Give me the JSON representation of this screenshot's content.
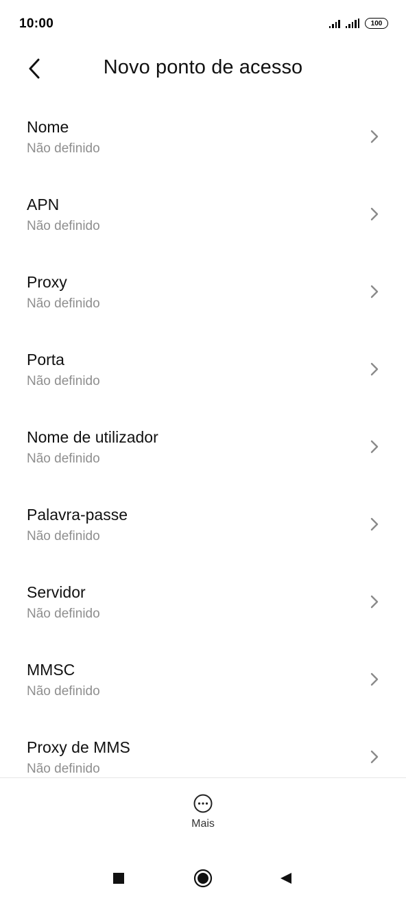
{
  "status_bar": {
    "time": "10:00",
    "battery": "100",
    "icons": [
      "signal-icon",
      "signal-icon",
      "battery-icon"
    ]
  },
  "header": {
    "title": "Novo ponto de acesso",
    "back_icon": "back-arrow-icon"
  },
  "fields": [
    {
      "label": "Nome",
      "value": "Não definido"
    },
    {
      "label": "APN",
      "value": "Não definido"
    },
    {
      "label": "Proxy",
      "value": "Não definido"
    },
    {
      "label": "Porta",
      "value": "Não definido"
    },
    {
      "label": "Nome de utilizador",
      "value": "Não definido"
    },
    {
      "label": "Palavra-passe",
      "value": "Não definido"
    },
    {
      "label": "Servidor",
      "value": "Não definido"
    },
    {
      "label": "MMSC",
      "value": "Não definido"
    },
    {
      "label": "Proxy de MMS",
      "value": "Não definido"
    }
  ],
  "footer": {
    "more_label": "Mais",
    "more_icon": "more-options-icon"
  },
  "nav": {
    "icons": [
      "recents-square-icon",
      "home-circle-icon",
      "back-triangle-icon"
    ]
  },
  "colors": {
    "text_primary": "#111111",
    "text_secondary": "#8e8e8e",
    "chevron": "#8a8a8a",
    "divider": "#e6e6e6"
  }
}
